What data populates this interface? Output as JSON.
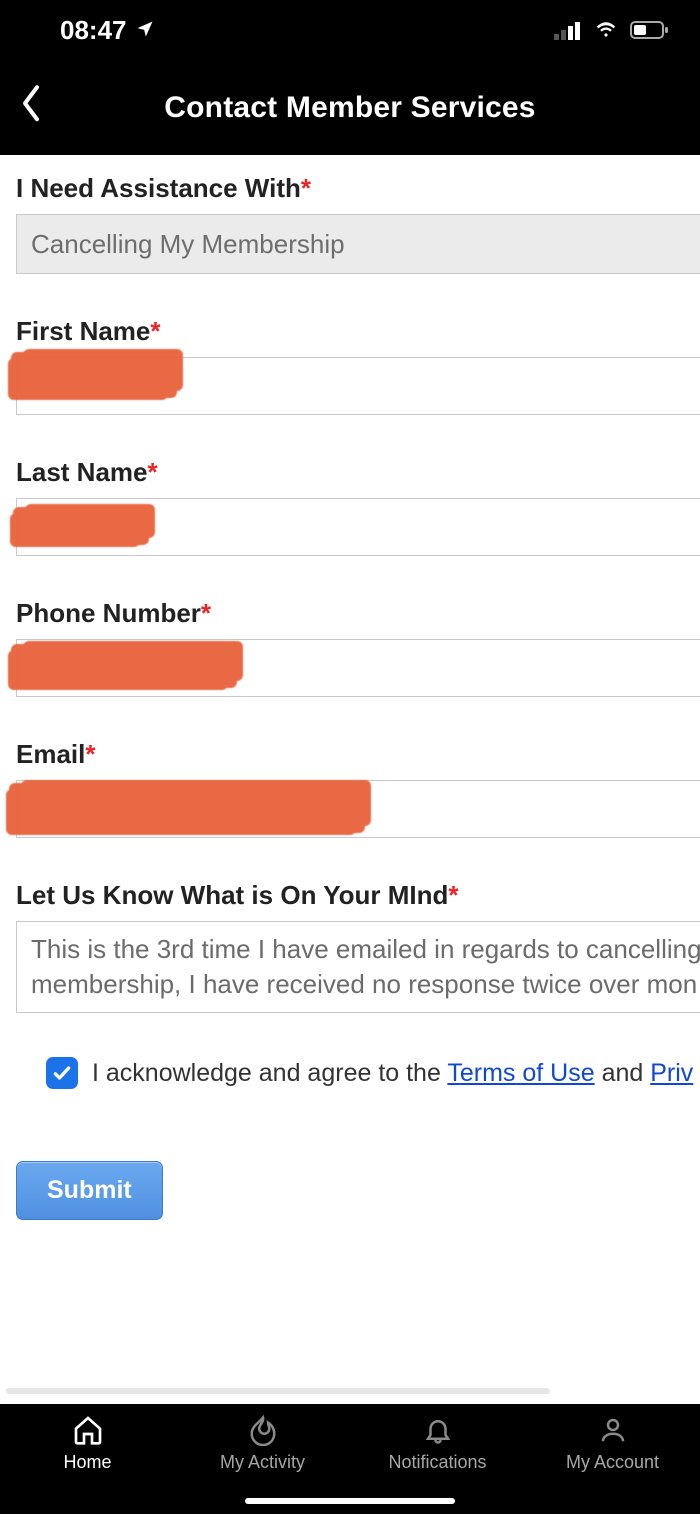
{
  "status": {
    "time": "08:47"
  },
  "header": {
    "title": "Contact Member Services"
  },
  "form": {
    "assist_label": "I Need Assistance With",
    "assist_value": "Cancelling My Membership",
    "first_name_label": "First Name",
    "last_name_label": "Last Name",
    "phone_label": "Phone Number",
    "email_label": "Email",
    "mind_label": "Let Us Know What is On Your MInd",
    "mind_line1": "This is the 3rd time I have emailed in regards to cancelling",
    "mind_line2": "membership, I have received no response twice over mon",
    "ack_prefix": "I acknowledge and agree to the ",
    "ack_terms": "Terms of Use",
    "ack_and": " and ",
    "ack_priv": "Priv",
    "submit": "Submit",
    "required_mark": "*"
  },
  "tabs": {
    "home": "Home",
    "activity": "My Activity",
    "notifications": "Notifications",
    "account": "My Account"
  }
}
